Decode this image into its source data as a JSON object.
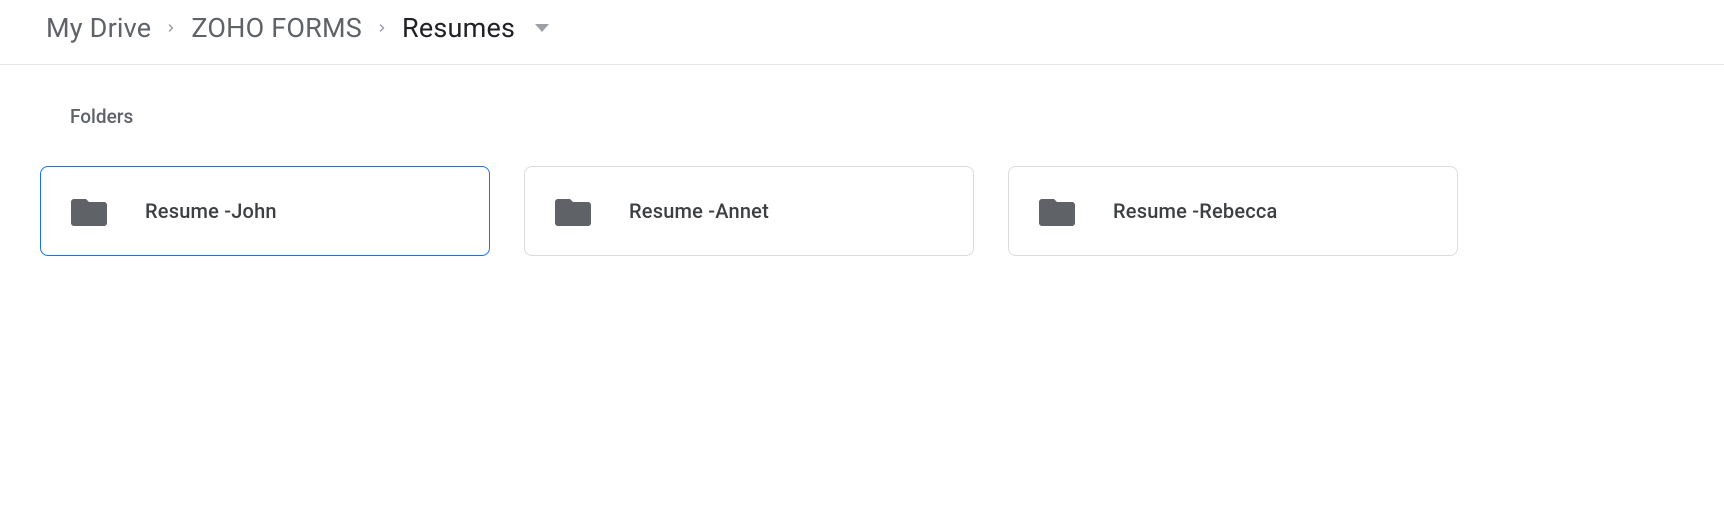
{
  "breadcrumb": {
    "items": [
      {
        "label": "My Drive"
      },
      {
        "label": "ZOHO FORMS"
      },
      {
        "label": "Resumes"
      }
    ]
  },
  "section": {
    "label": "Folders"
  },
  "folders": [
    {
      "name": "Resume -John",
      "selected": true
    },
    {
      "name": "Resume -Annet",
      "selected": false
    },
    {
      "name": "Resume -Rebecca",
      "selected": false
    }
  ]
}
